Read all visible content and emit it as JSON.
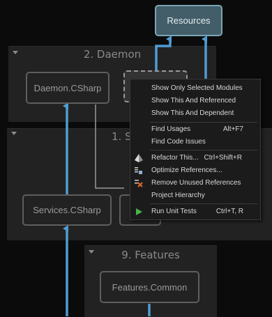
{
  "groups": {
    "daemon": "2. Daemon",
    "services": "1. S",
    "features": "9. Features"
  },
  "nodes": {
    "resources": "Resources",
    "daemon_csharp": "Daemon.CSharp",
    "services_csharp": "Services.CSharp",
    "features_common": "Features.Common"
  },
  "menu": {
    "show_selected": "Show Only Selected Modules",
    "show_referenced": "Show This And Referenced",
    "show_dependent": "Show This And Dependent",
    "find_usages": "Find Usages",
    "find_usages_sc": "Alt+F7",
    "find_code_issues": "Find Code Issues",
    "refactor": "Refactor This...",
    "refactor_sc": "Ctrl+Shift+R",
    "optimize_refs": "Optimize References...",
    "remove_unused": "Remove Unused References",
    "project_hierarchy": "Project Hierarchy",
    "run_unit_tests": "Run Unit Tests",
    "run_unit_tests_sc": "Ctrl+T, R"
  },
  "colors": {
    "background": "#0b0b0b",
    "group": "#222222",
    "edge_blue": "#4f9cd3",
    "edge_gray": "#9a9a9a",
    "highlight_node": "#435e69"
  }
}
